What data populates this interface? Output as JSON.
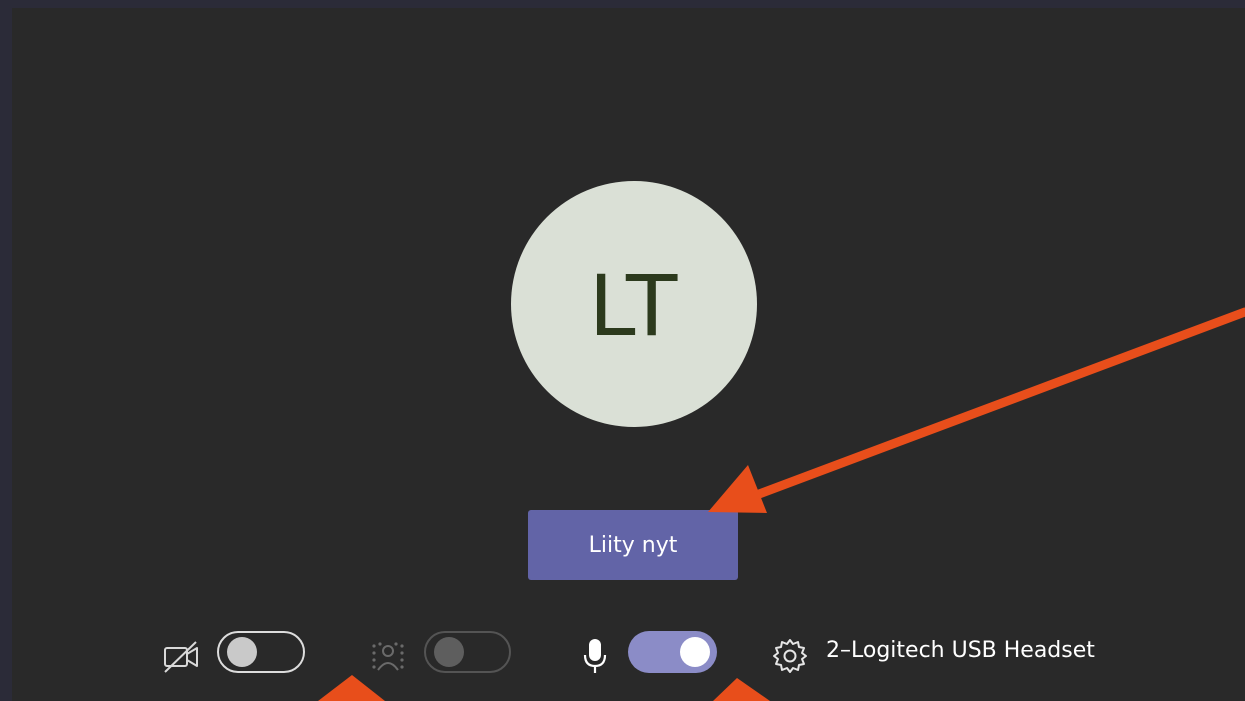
{
  "avatar": {
    "initials": "LT"
  },
  "join_button": {
    "label": "Liity nyt",
    "color": "#6264a7"
  },
  "controls": {
    "camera": {
      "icon": "video-off-icon",
      "enabled": false
    },
    "background_blur": {
      "icon": "background-blur-icon",
      "enabled": false,
      "disabled": true
    },
    "microphone": {
      "icon": "microphone-icon",
      "enabled": true,
      "accent": "#8b8cc7"
    },
    "device_settings": {
      "icon": "gear-icon",
      "label": "2–Logitech USB Headset"
    }
  },
  "annotations": {
    "arrow_color": "#e84e1b"
  }
}
